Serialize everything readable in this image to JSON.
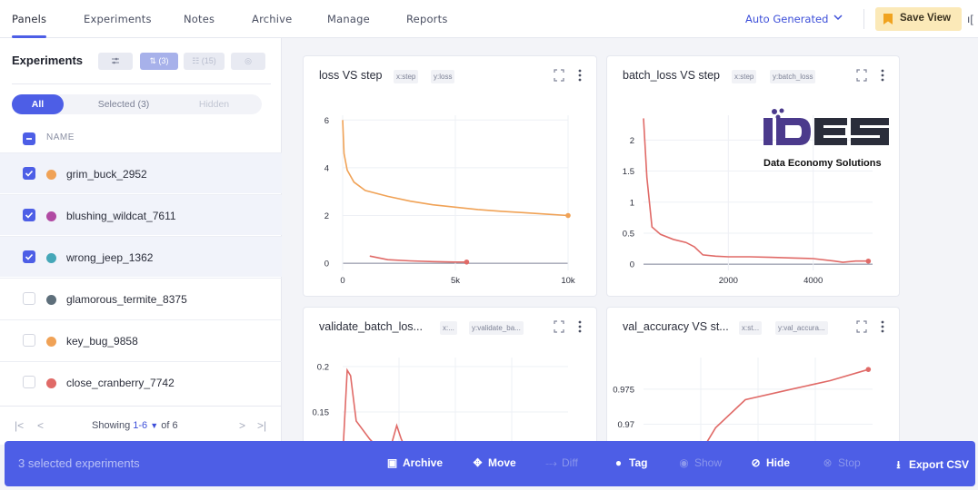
{
  "nav": {
    "tabs": [
      {
        "label": "Panels"
      },
      {
        "label": "Experiments"
      },
      {
        "label": "Notes"
      },
      {
        "label": "Archive"
      },
      {
        "label": "Manage"
      },
      {
        "label": "Reports"
      }
    ],
    "auto_generated_label": "Auto Generated",
    "save_view_label": "Save View"
  },
  "experiments_panel": {
    "title": "Experiments",
    "filter_pinned_count": "(3)",
    "filter_list_count": "(15)",
    "segments": {
      "all": "All",
      "selected": "Selected (3)",
      "hidden": "Hidden"
    },
    "name_header": "NAME",
    "rows": [
      {
        "name": "grim_buck_2952",
        "color": "#f0a256",
        "checked": true
      },
      {
        "name": "blushing_wildcat_7611",
        "color": "#b14aa3",
        "checked": true
      },
      {
        "name": "wrong_jeep_1362",
        "color": "#45a7b8",
        "checked": true
      },
      {
        "name": "glamorous_termite_8375",
        "color": "#5e6f7b",
        "checked": false
      },
      {
        "name": "key_bug_9858",
        "color": "#f0a256",
        "checked": false
      },
      {
        "name": "close_cranberry_7742",
        "color": "#e06a67",
        "checked": false
      }
    ],
    "pager": {
      "showing": "Showing",
      "range": "1-6",
      "of": "of 6"
    }
  },
  "panels": [
    {
      "title": "loss VS step",
      "chip_x": "x:step",
      "chip_y": "y:loss"
    },
    {
      "title": "batch_loss VS step",
      "chip_x": "x:step",
      "chip_y": "y:batch_loss"
    },
    {
      "title": "validate_batch_los...",
      "chip_x": "x:...",
      "chip_y": "y:validate_ba..."
    },
    {
      "title": "val_accuracy VS st...",
      "chip_x": "x:st...",
      "chip_y": "y:val_accura..."
    }
  ],
  "chart_data": [
    {
      "type": "line",
      "title": "loss VS step",
      "xlabel": "",
      "ylabel": "",
      "x_ticks": [
        "0",
        "5k",
        "10k"
      ],
      "y_ticks": [
        "0",
        "2",
        "4",
        "6"
      ],
      "xlim": [
        0,
        10000
      ],
      "ylim": [
        -0.3,
        6.2
      ],
      "series": [
        {
          "color": "#f0a256",
          "x": [
            0,
            60,
            200,
            500,
            1000,
            2000,
            3000,
            4000,
            5000,
            6000,
            7000,
            8000,
            9000,
            10000
          ],
          "y": [
            6.0,
            4.6,
            3.9,
            3.4,
            3.05,
            2.8,
            2.6,
            2.45,
            2.35,
            2.25,
            2.18,
            2.12,
            2.06,
            2.0
          ]
        },
        {
          "color": "#e06a67",
          "x": [
            1200,
            2000,
            3000,
            4000,
            5000,
            5500
          ],
          "y": [
            0.3,
            0.15,
            0.1,
            0.07,
            0.05,
            0.05
          ]
        }
      ]
    },
    {
      "type": "line",
      "title": "batch_loss VS step",
      "xlabel": "",
      "ylabel": "",
      "x_ticks": [
        "2000",
        "4000"
      ],
      "y_ticks": [
        "0",
        "0.5",
        "1",
        "1.5",
        "2"
      ],
      "xlim": [
        0,
        5400
      ],
      "ylim": [
        -0.1,
        2.4
      ],
      "series": [
        {
          "color": "#e06a67",
          "x": [
            0,
            80,
            200,
            400,
            700,
            1000,
            1200,
            1400,
            1700,
            2000,
            2500,
            3000,
            3500,
            4000,
            4500,
            4700,
            5000,
            5300
          ],
          "y": [
            2.35,
            1.4,
            0.6,
            0.48,
            0.4,
            0.35,
            0.28,
            0.15,
            0.13,
            0.12,
            0.12,
            0.11,
            0.1,
            0.09,
            0.05,
            0.03,
            0.05,
            0.05
          ]
        }
      ]
    },
    {
      "type": "line",
      "title": "validate_batch_los...",
      "xlabel": "",
      "ylabel": "",
      "x_ticks": [],
      "y_ticks": [
        "0.15",
        "0.2"
      ],
      "xlim": [
        0,
        10000
      ],
      "ylim": [
        0.09,
        0.21
      ],
      "series": [
        {
          "color": "#e06a67",
          "x": [
            0,
            200,
            350,
            600,
            1200,
            2000,
            2400,
            2600,
            3000,
            4000,
            5000,
            5300,
            6000,
            7000,
            8000,
            9000
          ],
          "y": [
            0.1,
            0.196,
            0.19,
            0.14,
            0.12,
            0.1,
            0.135,
            0.12,
            0.1,
            0.095,
            0.1,
            0.11,
            0.1,
            0.095,
            0.1,
            0.105
          ]
        }
      ]
    },
    {
      "type": "line",
      "title": "val_accuracy VS st...",
      "xlabel": "",
      "ylabel": "",
      "x_ticks": [],
      "y_ticks": [
        "0.97",
        "0.975"
      ],
      "xlim": [
        0,
        5400
      ],
      "ylim": [
        0.964,
        0.9795
      ],
      "series": [
        {
          "color": "#e06a67",
          "x": [
            1200,
            1700,
            2400,
            3500,
            4400,
            5300
          ],
          "y": [
            0.9645,
            0.9695,
            0.9735,
            0.975,
            0.9762,
            0.9778
          ]
        }
      ]
    }
  ],
  "action_bar": {
    "selected_text": "3 selected experiments",
    "actions": [
      {
        "label": "Archive",
        "enabled": true,
        "icon": "archive-icon"
      },
      {
        "label": "Move",
        "enabled": true,
        "icon": "move-icon"
      },
      {
        "label": "Diff",
        "enabled": false,
        "icon": "diff-icon"
      },
      {
        "label": "Tag",
        "enabled": true,
        "icon": "tag-icon"
      },
      {
        "label": "Show",
        "enabled": false,
        "icon": "eye-icon"
      },
      {
        "label": "Hide",
        "enabled": true,
        "icon": "eye-off-icon"
      },
      {
        "label": "Stop",
        "enabled": false,
        "icon": "stop-icon"
      },
      {
        "label": "Export CSV",
        "enabled": true,
        "icon": "download-icon"
      }
    ]
  },
  "watermark": {
    "text": "Data Economy Solutions",
    "logo_text": "1DES"
  },
  "colors": {
    "accent": "#4d5ee6",
    "save_view_bg": "#fbe9b8"
  }
}
